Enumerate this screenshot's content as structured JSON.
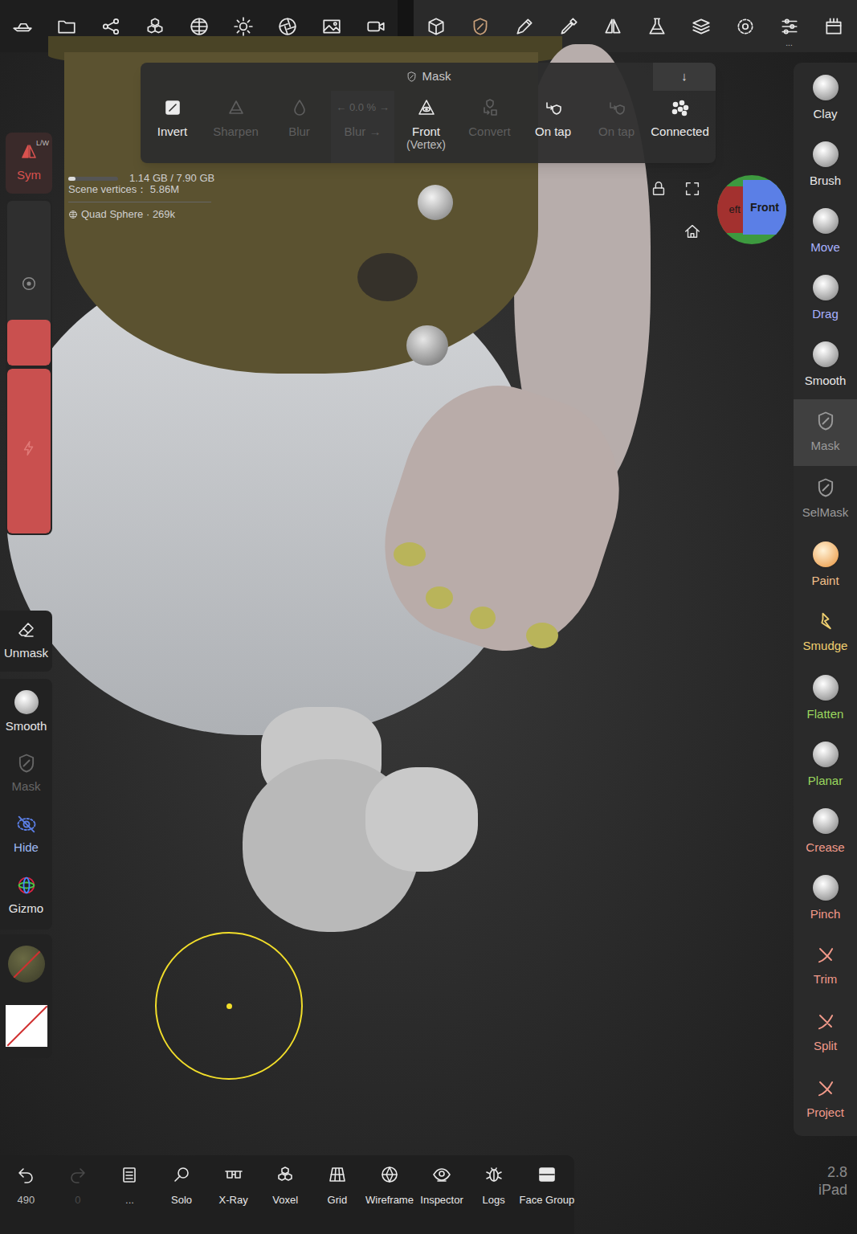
{
  "top_toolbar": [
    {
      "selected": false
    },
    {
      "selected": false,
      "sub": "..."
    },
    {
      "selected": false
    },
    {
      "selected": false,
      "sub": "..."
    },
    {
      "selected": false
    },
    {
      "selected": false
    },
    {
      "selected": false
    },
    {
      "selected": false
    },
    {
      "selected": false
    },
    {
      "selected": false
    },
    {
      "selected": true
    },
    {
      "selected": false,
      "sub": "..."
    },
    {
      "selected": false
    },
    {
      "selected": false
    },
    {
      "selected": false
    },
    {
      "selected": false
    },
    {
      "selected": false
    },
    {
      "selected": false,
      "sub": "..."
    },
    {
      "selected": false
    }
  ],
  "mask_panel": {
    "title": "Mask",
    "collapse": "↓",
    "tools": [
      {
        "label": "Invert",
        "disabled": false
      },
      {
        "label": "Sharpen",
        "disabled": true
      },
      {
        "label": "Blur",
        "disabled": true
      },
      {
        "label": "Blur →",
        "value": "← 0.0 % →",
        "disabled": true
      },
      {
        "label": "Front",
        "sub": "(Vertex)",
        "disabled": false
      },
      {
        "label": "Convert",
        "disabled": true
      },
      {
        "label": "On tap",
        "disabled": false
      },
      {
        "label": "On tap",
        "disabled": true
      },
      {
        "label": "Connected",
        "disabled": false
      }
    ]
  },
  "stats": {
    "memory": "1.14 GB / 7.90 GB",
    "memory_level": 0.14,
    "vertices": "Scene vertices： 5.86M",
    "object": "Quad Sphere · 269k"
  },
  "view_cube": {
    "left": "eft",
    "front": "Front"
  },
  "left_panel": {
    "sym": {
      "label": "Sym",
      "badge": "L/W",
      "on": true
    },
    "sliders": [
      {
        "level": 0.28
      },
      {
        "level": 1.0
      }
    ],
    "unmask": "Unmask",
    "tools": [
      {
        "label": "Smooth",
        "disabled": false
      },
      {
        "label": "Mask",
        "disabled": true
      },
      {
        "label": "Hide",
        "disabled": false
      },
      {
        "label": "Gizmo",
        "disabled": false
      }
    ]
  },
  "right_tools": [
    {
      "label": "Clay",
      "selected": false,
      "color": "#e8e8e8",
      "kind": "sphere"
    },
    {
      "label": "Brush",
      "selected": false,
      "color": "#e8e8e8",
      "kind": "sphere"
    },
    {
      "label": "Move",
      "selected": false,
      "color": "#a9b2ff",
      "kind": "sphere"
    },
    {
      "label": "Drag",
      "selected": false,
      "color": "#a9b2ff",
      "kind": "sphere"
    },
    {
      "label": "Smooth",
      "selected": false,
      "color": "#e8e8e8",
      "kind": "sphere"
    },
    {
      "label": "Mask",
      "selected": true,
      "color": "#9a9a9a",
      "kind": "shield"
    },
    {
      "label": "SelMask",
      "selected": false,
      "color": "#9a9a9a",
      "kind": "shield"
    },
    {
      "label": "Paint",
      "selected": false,
      "color": "#f2c08a",
      "kind": "sphere"
    },
    {
      "label": "Smudge",
      "selected": false,
      "color": "#f0d070",
      "kind": "smudge"
    },
    {
      "label": "Flatten",
      "selected": false,
      "color": "#9ad85e",
      "kind": "sphere"
    },
    {
      "label": "Planar",
      "selected": false,
      "color": "#9ad85e",
      "kind": "sphere"
    },
    {
      "label": "Crease",
      "selected": false,
      "color": "#f29a8a",
      "kind": "sphere"
    },
    {
      "label": "Pinch",
      "selected": false,
      "color": "#f29a8a",
      "kind": "sphere"
    },
    {
      "label": "Trim",
      "selected": false,
      "color": "#f29a8a",
      "kind": "cut"
    },
    {
      "label": "Split",
      "selected": false,
      "color": "#f29a8a",
      "kind": "cut"
    },
    {
      "label": "Project",
      "selected": false,
      "color": "#f29a8a",
      "kind": "cut"
    }
  ],
  "bottom_bar": [
    {
      "label": "490",
      "disabled": false
    },
    {
      "label": "0",
      "disabled": true
    },
    {
      "label": "...",
      "disabled": false
    },
    {
      "label": "Solo",
      "disabled": false
    },
    {
      "label": "X-Ray",
      "disabled": false
    },
    {
      "label": "Voxel",
      "disabled": false
    },
    {
      "label": "Grid",
      "disabled": false
    },
    {
      "label": "Wireframe",
      "disabled": false
    },
    {
      "label": "Inspector",
      "disabled": false
    },
    {
      "label": "Logs",
      "disabled": false
    },
    {
      "label": "Face Group",
      "disabled": false
    }
  ],
  "version": {
    "number": "2.8",
    "device": "iPad"
  }
}
